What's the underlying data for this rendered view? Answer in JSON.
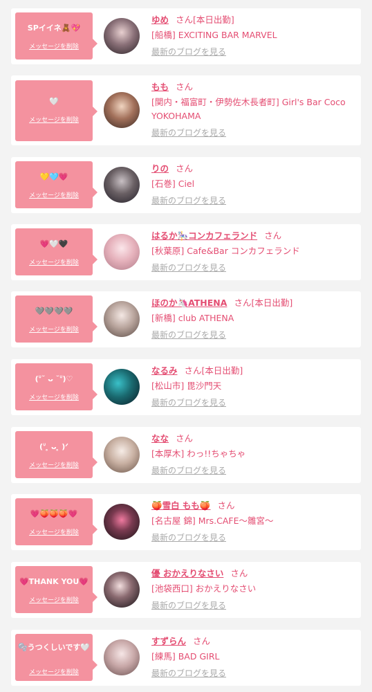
{
  "delete_label": "メッセージを削除",
  "blog_label": "最新のブログを見る",
  "san_label": "さん",
  "entries": [
    {
      "message": "SPイイネ🧸💖",
      "name": "ゆめ",
      "status": "[本日出勤]",
      "shop": "[船橋] EXCITING BAR MARVEL"
    },
    {
      "message": "🤍",
      "name": "もも",
      "status": "",
      "shop": "[関内・福富町・伊勢佐木長者町] Girl's Bar Coco YOKOHAMA"
    },
    {
      "message": "💛🩵💗",
      "name": "りの",
      "status": "",
      "shop": "[石巻] Ciel"
    },
    {
      "message": "💗🤍🖤",
      "name": "はるか🎠コンカフェランド",
      "status": "",
      "shop": "[秋葉原] Cafe&Bar コンカフェランド"
    },
    {
      "message": "🩶🩶🩶🩶",
      "name": "ほのか🦄ATHENA",
      "status": "[本日出勤]",
      "shop": "[新橋] club ATHENA"
    },
    {
      "message": "(ᐡ˘ ᴗ ˘ᐡ)♡",
      "name": "なるみ",
      "status": "[本日出勤]",
      "shop": "[松山市] 毘沙門天"
    },
    {
      "message": "(ᐡ ̥ ᴗ ̥ )ᐟ",
      "name": "なな",
      "status": "",
      "shop": "[本厚木] わっ!!ちゃちゃ"
    },
    {
      "message": "💗🍑🍑🍑💗",
      "name": "🍑雪白 もも🍑",
      "status": "",
      "shop": "[名古屋 錦] Mrs.CAFE〜雛宮〜"
    },
    {
      "message": "💗THANK YOU💗",
      "name": "優 おかえりなさい",
      "status": "",
      "shop": "[池袋西口] おかえりなさい"
    },
    {
      "message": "🫧うつくしいです🤍",
      "name": "すずらん",
      "status": "",
      "shop": "[練馬] BAD GIRL"
    }
  ]
}
